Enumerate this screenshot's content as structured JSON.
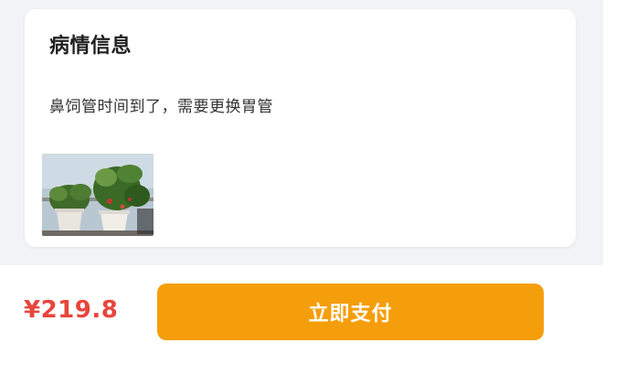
{
  "condition_card": {
    "title": "病情信息",
    "description": "鼻饲管时间到了，需要更换胃管",
    "photo_subject": "potted-plants-photo"
  },
  "footer": {
    "price": "¥219.8",
    "pay_button_label": "立即支付"
  },
  "colors": {
    "price": "#e8453c",
    "pay_button": "#f59e0b",
    "page_background": "#f2f3f7"
  }
}
